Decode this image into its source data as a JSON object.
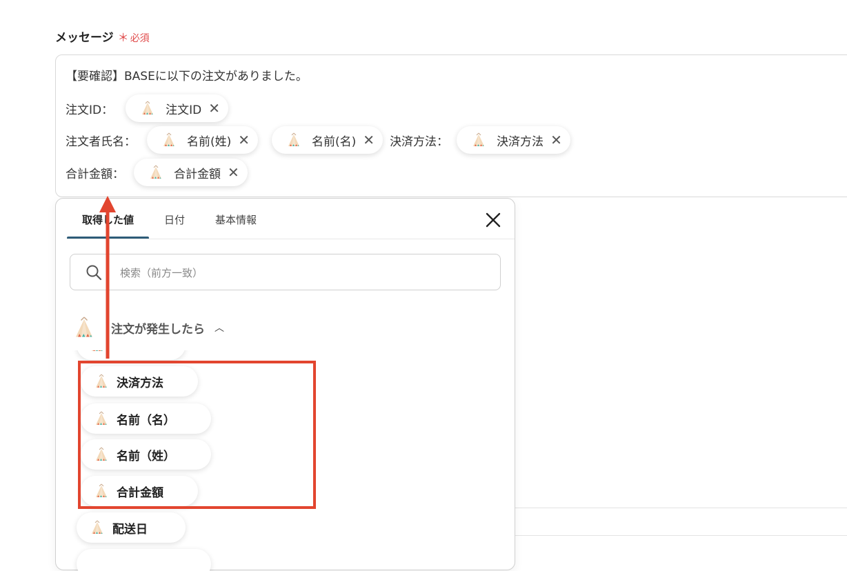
{
  "field": {
    "label": "メッセージ",
    "required_mark": "＊",
    "required_text": "必須"
  },
  "message": {
    "line1": "【要確認】BASEに以下の注文がありました。",
    "order_id_label": "注文ID：",
    "order_id_pill": "注文ID",
    "buyer_label": "注文者氏名：",
    "last_name_pill": "名前(姓)",
    "first_name_pill": "名前(名)",
    "payment_label": "決済方法：",
    "payment_pill": "決済方法",
    "total_label": "合計金額：",
    "total_pill": "合計金額"
  },
  "panel": {
    "tabs": [
      "取得した値",
      "日付",
      "基本情報"
    ],
    "search_placeholder": "検索（前方一致）",
    "section_name": "注文が発生したら",
    "items": [
      "決済方法",
      "名前（名）",
      "名前（姓）",
      "合計金額",
      "配送日"
    ]
  }
}
